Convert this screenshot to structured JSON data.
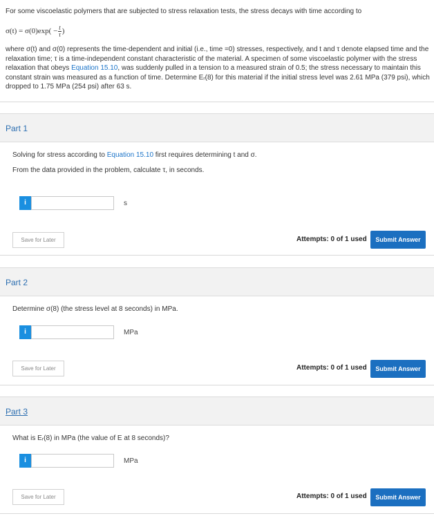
{
  "intro": {
    "text": "For some viscoelastic polymers that are subjected to stress relaxation tests, the stress decays with time according to",
    "formula": {
      "lhs": "σ(t) = σ(0)exp( −",
      "frac_num": "t",
      "frac_den": "τ",
      "rhs": ")"
    },
    "para_a": "where σ(t) and σ(0) represents the time-dependent and initial (i.e., time =0) stresses, respectively, and t and τ denote elapsed time and the relaxation time; τ is a time-independent constant characteristic of the material. A specimen of some viscoelastic polymer with the stress relaxation that obeys ",
    "para_link": "Equation 15.10",
    "para_b": ", was suddenly pulled in a tension to a measured strain of 0.5; the stress necessary to maintain this constant strain was measured as a function of time. Determine Eᵣ(8) for this material if the initial stress level was 2.61 MPa (379 psi), which dropped to 1.75 MPa (254 psi) after 63 s."
  },
  "parts": [
    {
      "title": "Part 1",
      "q1_a": "Solving for stress according to ",
      "q1_link": "Equation 15.10",
      "q1_b": " first requires determining t and σ.",
      "q2": "From the data provided in the problem, calculate τ, in seconds.",
      "unit": "s",
      "save": "Save for Later",
      "attempts": "Attempts: 0 of 1 used",
      "submit": "Submit Answer"
    },
    {
      "title": "Part 2",
      "q1": "Determine σ(8) (the stress level at 8 seconds) in MPa.",
      "unit": "MPa",
      "save": "Save for Later",
      "attempts": "Attempts: 0 of 1 used",
      "submit": "Submit Answer"
    },
    {
      "title": "Part 3",
      "q1": "What is Eᵣ(8) in MPa (the value of E at 8 seconds)?",
      "unit": "MPa",
      "save": "Save for Later",
      "attempts": "Attempts: 0 of 1 used",
      "submit": "Submit Answer"
    }
  ],
  "info_icon_glyph": "i",
  "colors": {
    "accent": "#1b6fc0",
    "info": "#1a8fe0",
    "link": "#1a73c8"
  }
}
